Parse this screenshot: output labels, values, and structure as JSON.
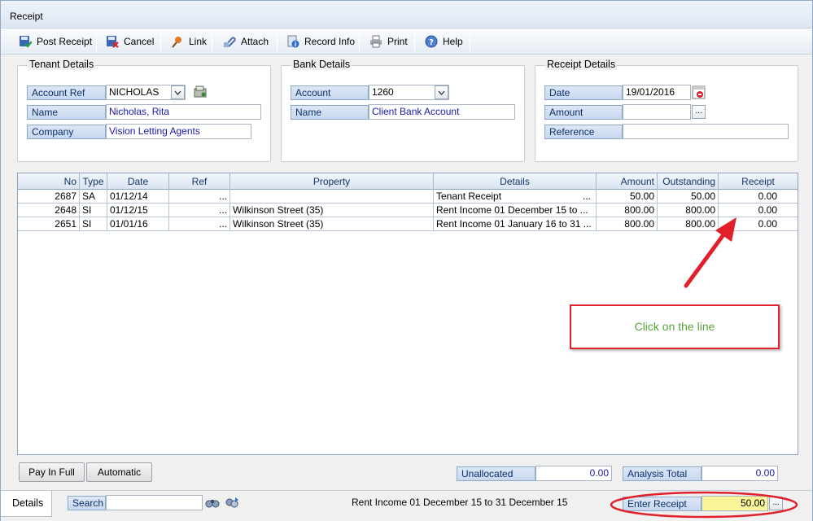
{
  "window": {
    "title": "Receipt"
  },
  "toolbar": {
    "post_receipt": "Post Receipt",
    "cancel": "Cancel",
    "link": "Link",
    "attach": "Attach",
    "record_info": "Record Info",
    "print": "Print",
    "help": "Help"
  },
  "tenant": {
    "title": "Tenant Details",
    "account_ref_label": "Account Ref",
    "account_ref_value": "NICHOLAS",
    "name_label": "Name",
    "name_value": "Nicholas, Rita",
    "company_label": "Company",
    "company_value": "Vision Letting Agents"
  },
  "bank": {
    "title": "Bank Details",
    "account_label": "Account",
    "account_value": "1260",
    "name_label": "Name",
    "name_value": "Client Bank Account"
  },
  "receipt": {
    "title": "Receipt Details",
    "date_label": "Date",
    "date_value": "19/01/2016",
    "amount_label": "Amount",
    "amount_value": "",
    "reference_label": "Reference",
    "reference_value": "",
    "ellipsis": "..."
  },
  "grid": {
    "headers": {
      "no": "No",
      "type": "Type",
      "date": "Date",
      "ref": "Ref",
      "property": "Property",
      "details": "Details",
      "amount": "Amount",
      "outstanding": "Outstanding",
      "receipt": "Receipt"
    },
    "rows": [
      {
        "no": "2687",
        "type": "SA",
        "date": "01/12/14",
        "ref": "...",
        "property": "",
        "details": "Tenant Receipt",
        "details_more": "...",
        "amount": "50.00",
        "outstanding": "50.00",
        "receipt": "0.00"
      },
      {
        "no": "2648",
        "type": "SI",
        "date": "01/12/15",
        "ref": "...",
        "property": "Wilkinson Street (35)",
        "details": "Rent Income 01 December 15 to ...",
        "details_more": "",
        "amount": "800.00",
        "outstanding": "800.00",
        "receipt": "0.00"
      },
      {
        "no": "2651",
        "type": "SI",
        "date": "01/01/16",
        "ref": "...",
        "property": "Wilkinson Street (35)",
        "details": "Rent Income 01 January 16 to 31 ...",
        "details_more": "",
        "amount": "800.00",
        "outstanding": "800.00",
        "receipt": "0.00"
      }
    ]
  },
  "annotation": {
    "callout_text": "Click on the line",
    "accent": "#e0202a"
  },
  "buttons": {
    "pay_in_full": "Pay In Full",
    "automatic": "Automatic"
  },
  "totals": {
    "unallocated_label": "Unallocated",
    "unallocated_value": "0.00",
    "analysis_total_label": "Analysis Total",
    "analysis_total_value": "0.00"
  },
  "status": {
    "tab_details": "Details",
    "search_label": "Search",
    "search_value": "",
    "info_text": "Rent Income 01 December 15 to 31 December 15",
    "enter_receipt_label": "Enter Receipt",
    "enter_receipt_value": "50.00",
    "ellipsis": "..."
  }
}
